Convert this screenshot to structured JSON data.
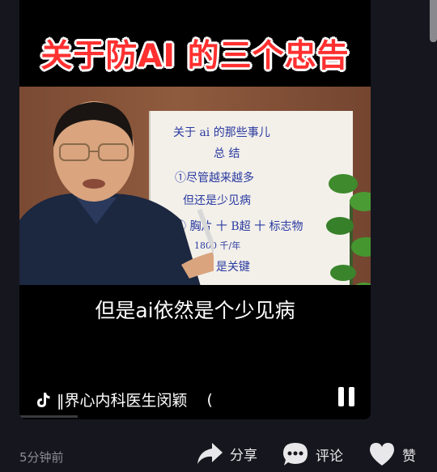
{
  "video": {
    "title_banner": "关于防AI 的三个忠告",
    "subtitle": "但是ai依然是个少见病",
    "author": "‖界心内科医生闵颖",
    "author_suffix": "(",
    "whiteboard_lines": [
      "关于 ai 的那些事儿",
      "总  结",
      "①尽管越来越多",
      "但还是少见病",
      "② 胸片 十 B超 十 标志物",
      "1800    千/年",
      "③ 注意        是关键"
    ]
  },
  "footer": {
    "time_ago": "5分钟前",
    "share_label": "分享",
    "comment_label": "评论",
    "like_label": "赞"
  },
  "icons": {
    "tiktok": "tiktok-logo-icon",
    "pause": "pause-icon",
    "share": "share-arrow-icon",
    "comment": "comment-bubble-icon",
    "like": "heart-icon"
  },
  "colors": {
    "background": "#16161e",
    "title_red": "#ff3030",
    "muted_text": "#8d8d95"
  }
}
